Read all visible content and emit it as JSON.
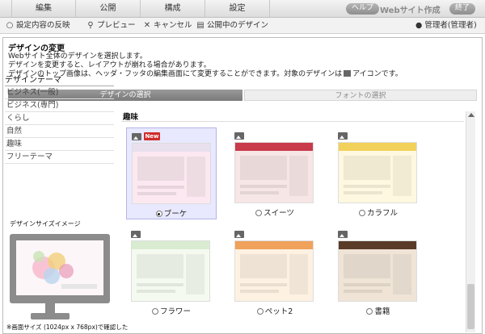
{
  "menu": {
    "tabs": [
      {
        "label": "編集"
      },
      {
        "label": "公開"
      },
      {
        "label": "構成"
      },
      {
        "label": "設定"
      }
    ],
    "help_label": "ヘルプ",
    "brand": "Webサイト作成",
    "exit_label": "終了"
  },
  "toolbar": {
    "items": [
      {
        "label": "設定内容の反映",
        "icon": "circle-icon"
      },
      {
        "label": "プレビュー",
        "icon": "magnifier-icon"
      },
      {
        "label": "キャンセル",
        "icon": "x-icon"
      },
      {
        "label": "公開中のデザイン",
        "icon": "page-icon"
      }
    ],
    "user": "管理者(管理者)"
  },
  "panel": {
    "title": "デザインの変更",
    "desc_line1": "Webサイト全体のデザインを選択します。",
    "desc_line2": "デザインを変更すると、レイアウトが崩れる場合があります。",
    "desc_line3a": "デザインのトップ画像は、ヘッダ・フッタの編集画面にて変更することができます。対象のデザインは",
    "desc_line3b": "アイコンです。",
    "tab_active": "デザインの選択",
    "tab_inactive": "フォントの選択"
  },
  "sidebar": {
    "heading": "デザインテーマ",
    "items": [
      {
        "label": "ビジネス(一般)"
      },
      {
        "label": "ビジネス(専門)"
      },
      {
        "label": "くらし"
      },
      {
        "label": "自然"
      },
      {
        "label": "趣味"
      },
      {
        "label": "フリーテーマ"
      }
    ],
    "size_title": "デザインサイズイメージ",
    "size_note": "※画面サイズ (1024px x 768px)で確認した"
  },
  "grid": {
    "title": "趣味",
    "new_badge": "New",
    "designs": [
      {
        "label": "ブーケ",
        "selected": true,
        "new": true,
        "head": "#e9e0ee",
        "body": "#fbe8f0"
      },
      {
        "label": "スイーツ",
        "selected": false,
        "new": false,
        "head": "#c93a4a",
        "body": "#f7e6e6"
      },
      {
        "label": "カラフル",
        "selected": false,
        "new": false,
        "head": "#f2d15a",
        "body": "#fff8e0"
      },
      {
        "label": "フラワー",
        "selected": false,
        "new": false,
        "head": "#d9ecd2",
        "body": "#f4faf0"
      },
      {
        "label": "ペット2",
        "selected": false,
        "new": false,
        "head": "#f0a15a",
        "body": "#fdf1e2"
      },
      {
        "label": "書籍",
        "selected": false,
        "new": false,
        "head": "#5a3b28",
        "body": "#efe4d6"
      }
    ]
  }
}
